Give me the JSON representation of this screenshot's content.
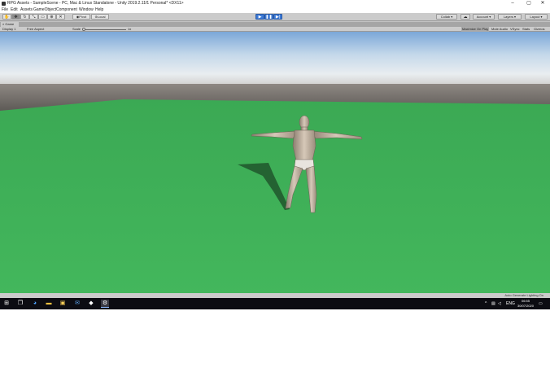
{
  "window": {
    "title": "RPG Assets - SampleScene - PC, Mac & Linux Standalone - Unity 2019.2.11f1 Personal* <DX11>",
    "minimize": "–",
    "maximize": "▢",
    "close": "✕"
  },
  "menu": [
    "File",
    "Edit",
    "Assets",
    "GameObject",
    "Component",
    "Window",
    "Help"
  ],
  "toolbar": {
    "pivot_label": "Pivot",
    "space_label": "Local",
    "collab_label": "Collab ▾",
    "account_label": "Account ▾",
    "layers_label": "Layers ▾",
    "layout_label": "Layout ▾"
  },
  "game_tab": {
    "label": "Game",
    "display": "Display 1",
    "aspect": "Free Aspect",
    "scale_label": "Scale",
    "scale_value": "1x",
    "maximize_on_play": "Maximize On Play",
    "mute_audio": "Mute Audio",
    "vsync": "VSync",
    "stats": "Stats",
    "gizmos": "Gizmos"
  },
  "status": {
    "text": "Auto Generate Lighting On"
  },
  "taskbar": {
    "language": "ENG",
    "time": "06:55",
    "date": "30/07/2020"
  },
  "colors": {
    "ground": "#3fb558",
    "sky_top": "#7aa6d6",
    "horizon": "#6e6a66",
    "play_blue": "#3d7ad6",
    "taskbar": "#0c0c12"
  }
}
